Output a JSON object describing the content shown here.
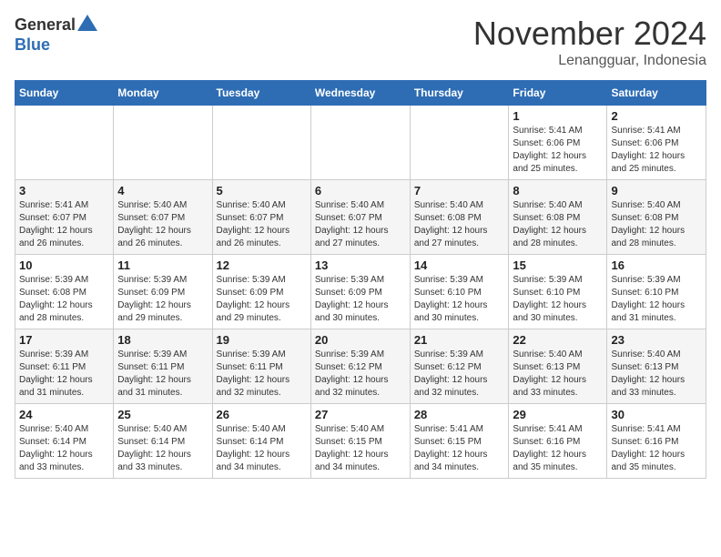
{
  "header": {
    "logo_general": "General",
    "logo_blue": "Blue",
    "month": "November 2024",
    "location": "Lenangguar, Indonesia"
  },
  "weekdays": [
    "Sunday",
    "Monday",
    "Tuesday",
    "Wednesday",
    "Thursday",
    "Friday",
    "Saturday"
  ],
  "weeks": [
    [
      {
        "day": "",
        "info": ""
      },
      {
        "day": "",
        "info": ""
      },
      {
        "day": "",
        "info": ""
      },
      {
        "day": "",
        "info": ""
      },
      {
        "day": "",
        "info": ""
      },
      {
        "day": "1",
        "info": "Sunrise: 5:41 AM\nSunset: 6:06 PM\nDaylight: 12 hours and 25 minutes."
      },
      {
        "day": "2",
        "info": "Sunrise: 5:41 AM\nSunset: 6:06 PM\nDaylight: 12 hours and 25 minutes."
      }
    ],
    [
      {
        "day": "3",
        "info": "Sunrise: 5:41 AM\nSunset: 6:07 PM\nDaylight: 12 hours and 26 minutes."
      },
      {
        "day": "4",
        "info": "Sunrise: 5:40 AM\nSunset: 6:07 PM\nDaylight: 12 hours and 26 minutes."
      },
      {
        "day": "5",
        "info": "Sunrise: 5:40 AM\nSunset: 6:07 PM\nDaylight: 12 hours and 26 minutes."
      },
      {
        "day": "6",
        "info": "Sunrise: 5:40 AM\nSunset: 6:07 PM\nDaylight: 12 hours and 27 minutes."
      },
      {
        "day": "7",
        "info": "Sunrise: 5:40 AM\nSunset: 6:08 PM\nDaylight: 12 hours and 27 minutes."
      },
      {
        "day": "8",
        "info": "Sunrise: 5:40 AM\nSunset: 6:08 PM\nDaylight: 12 hours and 28 minutes."
      },
      {
        "day": "9",
        "info": "Sunrise: 5:40 AM\nSunset: 6:08 PM\nDaylight: 12 hours and 28 minutes."
      }
    ],
    [
      {
        "day": "10",
        "info": "Sunrise: 5:39 AM\nSunset: 6:08 PM\nDaylight: 12 hours and 28 minutes."
      },
      {
        "day": "11",
        "info": "Sunrise: 5:39 AM\nSunset: 6:09 PM\nDaylight: 12 hours and 29 minutes."
      },
      {
        "day": "12",
        "info": "Sunrise: 5:39 AM\nSunset: 6:09 PM\nDaylight: 12 hours and 29 minutes."
      },
      {
        "day": "13",
        "info": "Sunrise: 5:39 AM\nSunset: 6:09 PM\nDaylight: 12 hours and 30 minutes."
      },
      {
        "day": "14",
        "info": "Sunrise: 5:39 AM\nSunset: 6:10 PM\nDaylight: 12 hours and 30 minutes."
      },
      {
        "day": "15",
        "info": "Sunrise: 5:39 AM\nSunset: 6:10 PM\nDaylight: 12 hours and 30 minutes."
      },
      {
        "day": "16",
        "info": "Sunrise: 5:39 AM\nSunset: 6:10 PM\nDaylight: 12 hours and 31 minutes."
      }
    ],
    [
      {
        "day": "17",
        "info": "Sunrise: 5:39 AM\nSunset: 6:11 PM\nDaylight: 12 hours and 31 minutes."
      },
      {
        "day": "18",
        "info": "Sunrise: 5:39 AM\nSunset: 6:11 PM\nDaylight: 12 hours and 31 minutes."
      },
      {
        "day": "19",
        "info": "Sunrise: 5:39 AM\nSunset: 6:11 PM\nDaylight: 12 hours and 32 minutes."
      },
      {
        "day": "20",
        "info": "Sunrise: 5:39 AM\nSunset: 6:12 PM\nDaylight: 12 hours and 32 minutes."
      },
      {
        "day": "21",
        "info": "Sunrise: 5:39 AM\nSunset: 6:12 PM\nDaylight: 12 hours and 32 minutes."
      },
      {
        "day": "22",
        "info": "Sunrise: 5:40 AM\nSunset: 6:13 PM\nDaylight: 12 hours and 33 minutes."
      },
      {
        "day": "23",
        "info": "Sunrise: 5:40 AM\nSunset: 6:13 PM\nDaylight: 12 hours and 33 minutes."
      }
    ],
    [
      {
        "day": "24",
        "info": "Sunrise: 5:40 AM\nSunset: 6:14 PM\nDaylight: 12 hours and 33 minutes."
      },
      {
        "day": "25",
        "info": "Sunrise: 5:40 AM\nSunset: 6:14 PM\nDaylight: 12 hours and 33 minutes."
      },
      {
        "day": "26",
        "info": "Sunrise: 5:40 AM\nSunset: 6:14 PM\nDaylight: 12 hours and 34 minutes."
      },
      {
        "day": "27",
        "info": "Sunrise: 5:40 AM\nSunset: 6:15 PM\nDaylight: 12 hours and 34 minutes."
      },
      {
        "day": "28",
        "info": "Sunrise: 5:41 AM\nSunset: 6:15 PM\nDaylight: 12 hours and 34 minutes."
      },
      {
        "day": "29",
        "info": "Sunrise: 5:41 AM\nSunset: 6:16 PM\nDaylight: 12 hours and 35 minutes."
      },
      {
        "day": "30",
        "info": "Sunrise: 5:41 AM\nSunset: 6:16 PM\nDaylight: 12 hours and 35 minutes."
      }
    ]
  ]
}
